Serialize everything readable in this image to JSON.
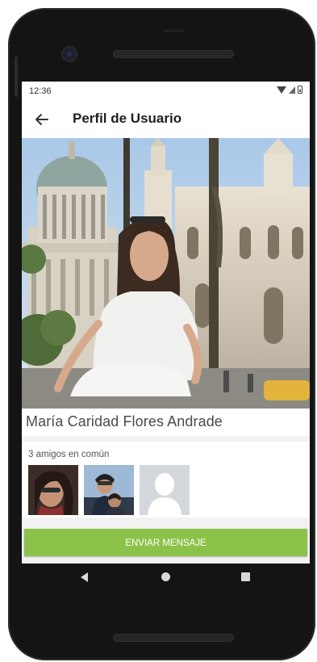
{
  "status_bar": {
    "time": "12:36",
    "icons": [
      "wifi-icon",
      "signal-icon",
      "battery-icon"
    ]
  },
  "app_bar": {
    "back_icon": "arrow-left-icon",
    "title": "Perfil de Usuario"
  },
  "profile": {
    "name": "María Caridad Flores Andrade"
  },
  "friends": {
    "label": "3 amigos en común",
    "items": [
      "friend-photo-1",
      "friend-photo-2",
      "friend-placeholder"
    ]
  },
  "actions": {
    "send_message": "ENVIAR MENSAJE"
  },
  "nav": {
    "back": "nav-back-icon",
    "home": "nav-home-icon",
    "recents": "nav-recents-icon"
  },
  "colors": {
    "accent": "#8bc34a",
    "background": "#f2f2f2",
    "phone_frame": "#141414"
  }
}
